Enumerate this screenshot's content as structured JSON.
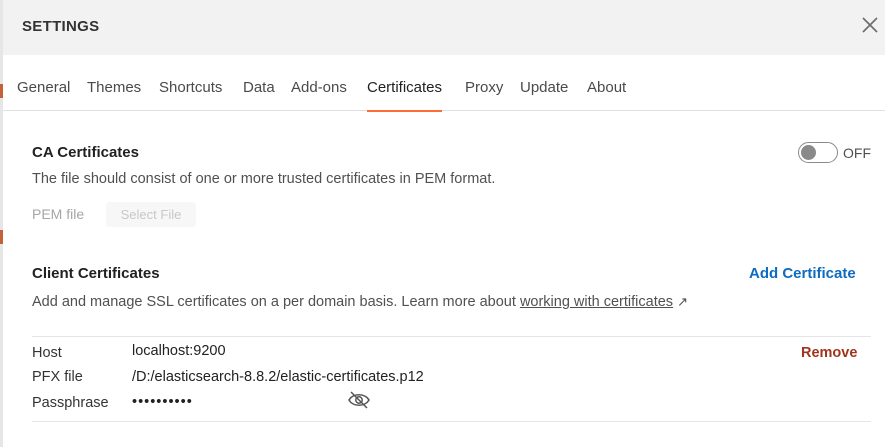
{
  "window": {
    "title": "SETTINGS"
  },
  "tabs": [
    {
      "label": "General"
    },
    {
      "label": "Themes"
    },
    {
      "label": "Shortcuts"
    },
    {
      "label": "Data"
    },
    {
      "label": "Add-ons"
    },
    {
      "label": "Certificates",
      "active": true
    },
    {
      "label": "Proxy"
    },
    {
      "label": "Update"
    },
    {
      "label": "About"
    }
  ],
  "ca": {
    "title": "CA Certificates",
    "toggle_state": "OFF",
    "description": "The file should consist of one or more trusted certificates in PEM format.",
    "pem_label": "PEM file",
    "select_file_label": "Select File"
  },
  "client": {
    "title": "Client Certificates",
    "add_label": "Add Certificate",
    "description_prefix": "Add and manage SSL certificates on a per domain basis. Learn more about ",
    "link_text": "working with certificates",
    "link_arrow": "↗",
    "certificate": {
      "host_label": "Host",
      "host_value": "localhost:9200",
      "pfx_label": "PFX file",
      "pfx_value": "/D:/elasticsearch-8.8.2/elastic-certificates.p12",
      "passphrase_label": "Passphrase",
      "passphrase_value": "••••••••••",
      "remove_label": "Remove"
    }
  },
  "colors": {
    "accent": "#ff6c37",
    "link": "#0d6bc1",
    "danger": "#a1341e"
  },
  "icons": {
    "close": "close-icon",
    "eye": "eye-off-icon",
    "external": "external-link-icon"
  }
}
